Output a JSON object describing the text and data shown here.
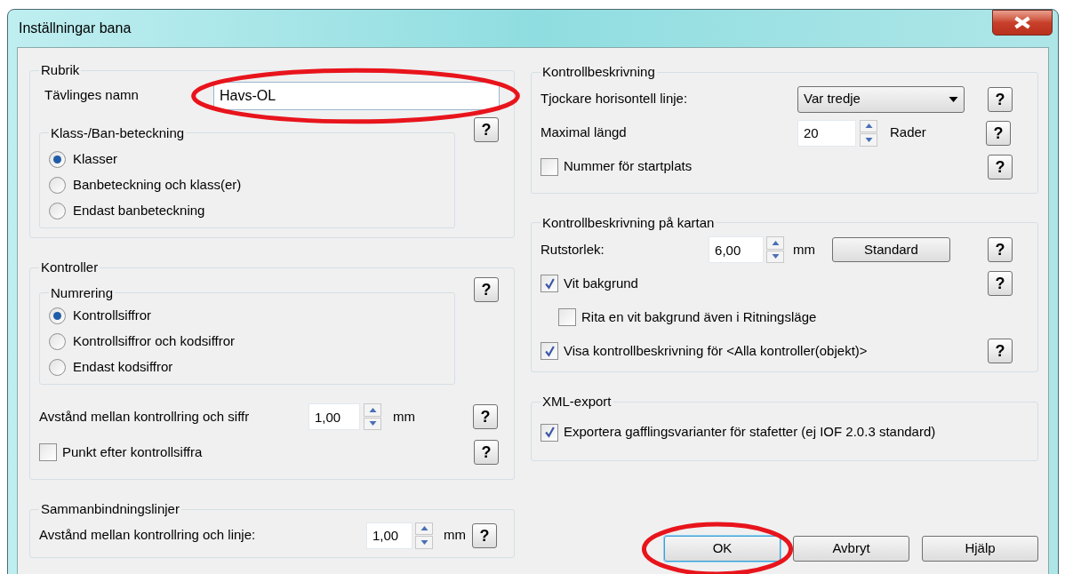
{
  "window": {
    "title": "Inställningar bana"
  },
  "rubrik": {
    "legend": "Rubrik",
    "name_label": "Tävlinges namn",
    "name_field": {
      "value": "Havs-OL",
      "circled": true
    },
    "subgroup": {
      "legend": "Klass-/Ban-beteckning",
      "help": "?",
      "options": [
        {
          "label": "Klasser",
          "selected": true
        },
        {
          "label": "Banbeteckning och klass(er)",
          "selected": false
        },
        {
          "label": "Endast banbeteckning",
          "selected": false
        }
      ]
    }
  },
  "kontroller": {
    "legend": "Kontroller",
    "subgroup": {
      "legend": "Numrering",
      "help": "?",
      "options": [
        {
          "label": "Kontrollsiffror",
          "selected": true
        },
        {
          "label": "Kontrollsiffror och kodsiffror",
          "selected": false
        },
        {
          "label": "Endast kodsiffror",
          "selected": false
        }
      ]
    },
    "distance": {
      "label": "Avstånd mellan kontrollring och siffr",
      "value": "1,00",
      "unit": "mm",
      "help": "?"
    },
    "dot": {
      "label": "Punkt efter kontrollsiffra",
      "checked": false,
      "help": "?"
    }
  },
  "sammanbindning": {
    "legend": "Sammanbindningslinjer",
    "distance": {
      "label": "Avstånd mellan kontrollring och linje:",
      "value": "1,00",
      "unit": "mm",
      "help": "?"
    }
  },
  "kontrollbeskrivning": {
    "legend": "Kontrollbeskrivning",
    "thicker": {
      "label": "Tjockare horisontell linje:",
      "value": "Var tredje",
      "help": "?"
    },
    "max_length": {
      "label": "Maximal längd",
      "value": "20",
      "unit": "Rader",
      "help": "?"
    },
    "start_number": {
      "label": "Nummer för startplats",
      "checked": false,
      "help": "?"
    }
  },
  "karta": {
    "legend": "Kontrollbeskrivning på kartan",
    "size": {
      "label": "Rutstorlek:",
      "value": "6,00",
      "unit": "mm",
      "button": "Standard",
      "help": "?"
    },
    "checks": [
      {
        "label": "Vit bakgrund",
        "checked": true,
        "help": "?",
        "children": [
          {
            "label": "Rita en vit bakgrund även i Ritningsläge",
            "checked": false
          }
        ]
      },
      {
        "label": "Visa kontrollbeskrivning för <Alla kontroller(objekt)>",
        "checked": true,
        "help": "?"
      }
    ]
  },
  "xml": {
    "legend": "XML-export",
    "checks": [
      {
        "label": "Exportera gafflingsvarianter för stafetter (ej IOF 2.0.3 standard)",
        "checked": true
      }
    ]
  },
  "buttons": [
    {
      "label": "OK",
      "focused": true,
      "circled": true
    },
    {
      "label": "Avbryt",
      "focused": false,
      "circled": false
    },
    {
      "label": "Hjälp",
      "focused": false,
      "circled": false
    }
  ]
}
